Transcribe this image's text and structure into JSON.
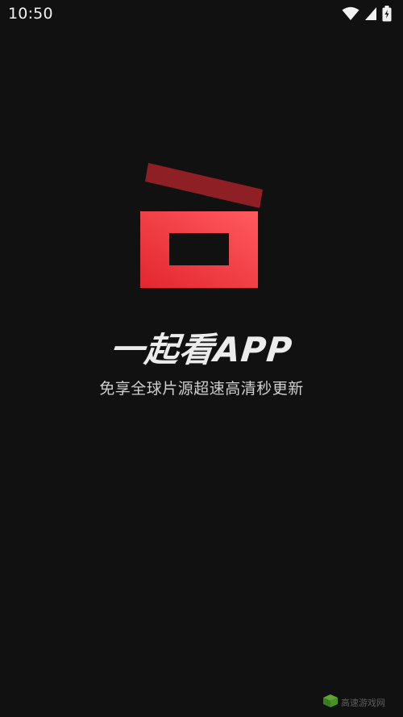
{
  "status_bar": {
    "time": "10:50",
    "icons": [
      "wifi-icon",
      "signal-icon",
      "battery-icon"
    ]
  },
  "splash": {
    "app_name": "一起看APP",
    "tagline": "免享全球片源超速高清秒更新",
    "logo_icon": "clapperboard-icon",
    "colors": {
      "background": "#111111",
      "logo_red": "#e8343a",
      "logo_dark_red": "#8e2025",
      "title": "#ececec",
      "tagline": "#cfcfcf"
    }
  },
  "watermark": {
    "text": "高速游戏网"
  }
}
